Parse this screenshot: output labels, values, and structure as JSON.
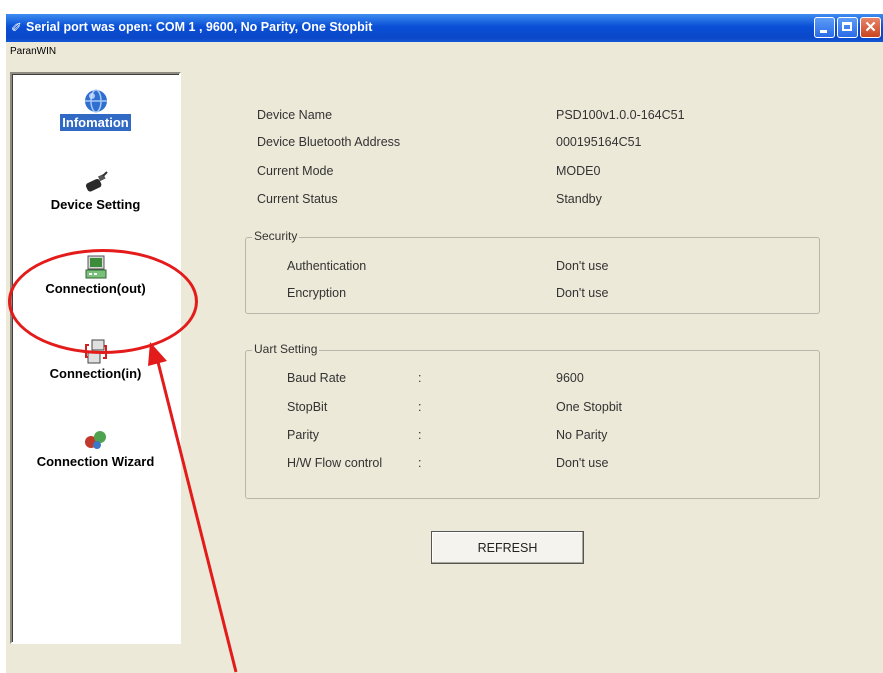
{
  "window": {
    "title": "Serial port was open: COM 1 , 9600, No Parity, One Stopbit",
    "menu": [
      "ParanWIN"
    ]
  },
  "sidebar": {
    "items": [
      {
        "label": "Infomation",
        "icon": "info-globe-icon",
        "active": true
      },
      {
        "label": "Device Setting",
        "icon": "device-plug-icon",
        "active": false
      },
      {
        "label": "Connection(out)",
        "icon": "connection-out-icon",
        "active": false
      },
      {
        "label": "Connection(in)",
        "icon": "connection-in-icon",
        "active": false
      },
      {
        "label": "Connection Wizard",
        "icon": "wizard-icon",
        "active": false
      }
    ]
  },
  "info": {
    "rows": [
      {
        "label": "Device Name",
        "value": "PSD100v1.0.0-164C51"
      },
      {
        "label": "Device Bluetooth Address",
        "value": "000195164C51"
      },
      {
        "label": "Current Mode",
        "value": "MODE0"
      },
      {
        "label": "Current Status",
        "value": "Standby"
      }
    ]
  },
  "security": {
    "title": "Security",
    "rows": [
      {
        "label": "Authentication",
        "value": "Don't use"
      },
      {
        "label": "Encryption",
        "value": "Don't use"
      }
    ]
  },
  "uart": {
    "title": "Uart Setting",
    "rows": [
      {
        "label": "Baud Rate",
        "sep": ":",
        "value": "9600"
      },
      {
        "label": "StopBit",
        "sep": ":",
        "value": "One Stopbit"
      },
      {
        "label": "Parity",
        "sep": ":",
        "value": "No Parity"
      },
      {
        "label": "H/W Flow control",
        "sep": ":",
        "value": "Don't use"
      }
    ]
  },
  "buttons": {
    "refresh": "REFRESH"
  },
  "annotation": {
    "color": "#e41b1b"
  },
  "colors": {
    "title_bar": "#0a4fd6",
    "active_item": "#316ac5",
    "window_bg": "#ece9d8"
  }
}
